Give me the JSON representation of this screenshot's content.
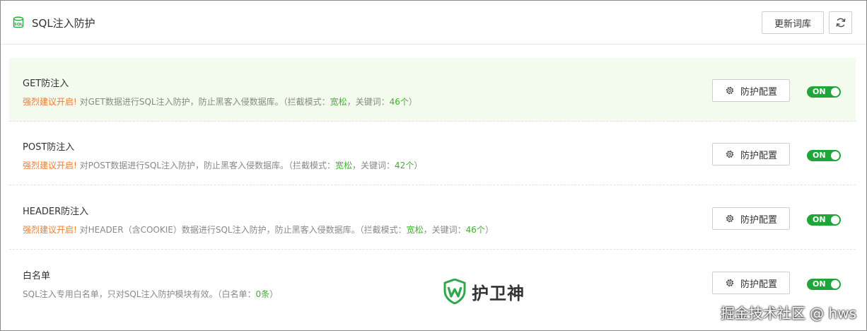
{
  "header": {
    "title": "SQL注入防护",
    "update_button": "更新词库",
    "icons": {
      "db": "sql-database-icon",
      "refresh": "refresh-icon"
    }
  },
  "rows": [
    {
      "name": "GET防注入",
      "warn": "强烈建议开启!",
      "desc": " 对GET数据进行SQL注入防护，防止黑客入侵数据库。（拦截模式：",
      "mode": "宽松",
      "sep": "，关键词：",
      "count": "46个",
      "end": "）",
      "config_label": "防护配置",
      "toggle_label": "ON"
    },
    {
      "name": "POST防注入",
      "warn": "强烈建议开启!",
      "desc": " 对POST数据进行SQL注入防护，防止黑客入侵数据库。（拦截模式：",
      "mode": "宽松",
      "sep": "，关键词：",
      "count": "42个",
      "end": "）",
      "config_label": "防护配置",
      "toggle_label": "ON"
    },
    {
      "name": "HEADER防注入",
      "warn": "强烈建议开启!",
      "desc": " 对HEADER（含COOKIE）数据进行SQL注入防护，防止黑客入侵数据库。（拦截模式：",
      "mode": "宽松",
      "sep": "，关键词：",
      "count": "46个",
      "end": "）",
      "config_label": "防护配置",
      "toggle_label": "ON"
    },
    {
      "name": "白名单",
      "desc": "SQL注入专用白名单，只对SQL注入防护模块有效。（白名单：",
      "count": "0条",
      "end": "）",
      "config_label": "防护配置",
      "toggle_label": "ON"
    }
  ],
  "colors": {
    "accent": "#20a53a",
    "warning": "#ef7a2d",
    "value": "#3fb12c",
    "highlight_row": "#f3fbee"
  },
  "watermark": {
    "text": "护卫神",
    "icon": "shield-w-logo"
  },
  "source_credit": "掘金技术社区 @ hws"
}
